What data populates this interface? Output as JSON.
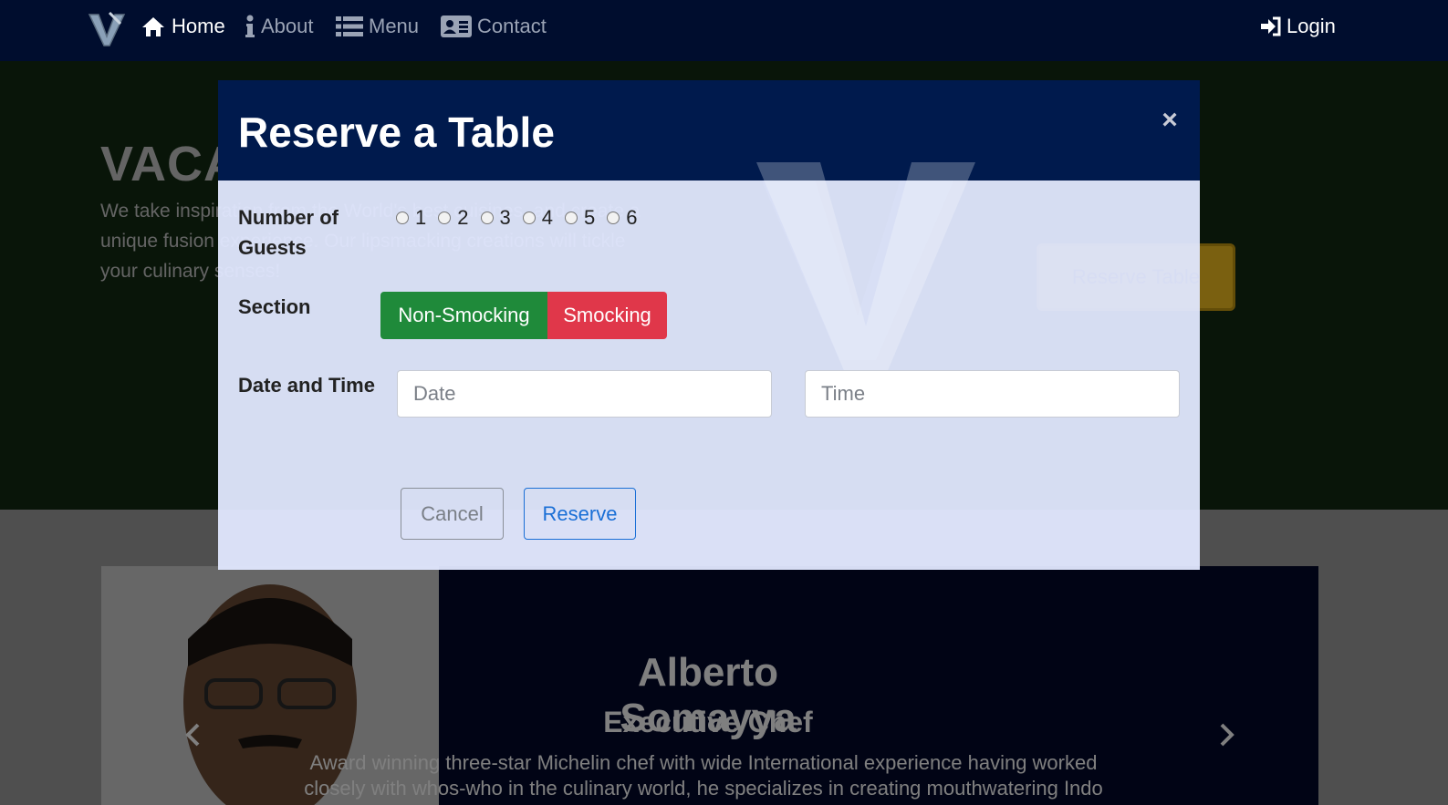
{
  "navbar": {
    "home": "Home",
    "about": "About",
    "menu": "Menu",
    "contact": "Contact",
    "login": "Login"
  },
  "hero": {
    "title": "VACANZA",
    "text": "We take inspiration from the World's best cuisines, and create a unique fusion experience. Our lipsmacking creations will tickle your culinary senses!",
    "button": "Reserve Table"
  },
  "carousel": {
    "name": "Alberto Somayya",
    "role": "Executive Chef",
    "description": "Award winning three-star Michelin chef with wide International experience having worked closely with whos-who in the culinary world, he specializes in creating mouthwatering Indo"
  },
  "modal": {
    "title": "Reserve a Table",
    "close": "×",
    "guests_label": "Number of Guests",
    "guest_options": [
      "1",
      "2",
      "3",
      "4",
      "5",
      "6"
    ],
    "section_label": "Section",
    "non_smoking": "Non-Smocking",
    "smoking": "Smocking",
    "datetime_label": "Date and Time",
    "date_placeholder": "Date",
    "time_placeholder": "Time",
    "cancel": "Cancel",
    "reserve": "Reserve"
  },
  "colors": {
    "navbar": "#000d2e",
    "modal_header": "#001a4d",
    "non_smoking": "#1f8a3a",
    "smoking": "#e0374a",
    "reserve_accent": "#1a6fd6",
    "hero_button": "#f5c021"
  },
  "icons": {
    "brand": "vacanza-logo",
    "home": "home-icon",
    "about": "info-icon",
    "menu": "list-icon",
    "contact": "address-card-icon",
    "login": "sign-in-icon"
  }
}
